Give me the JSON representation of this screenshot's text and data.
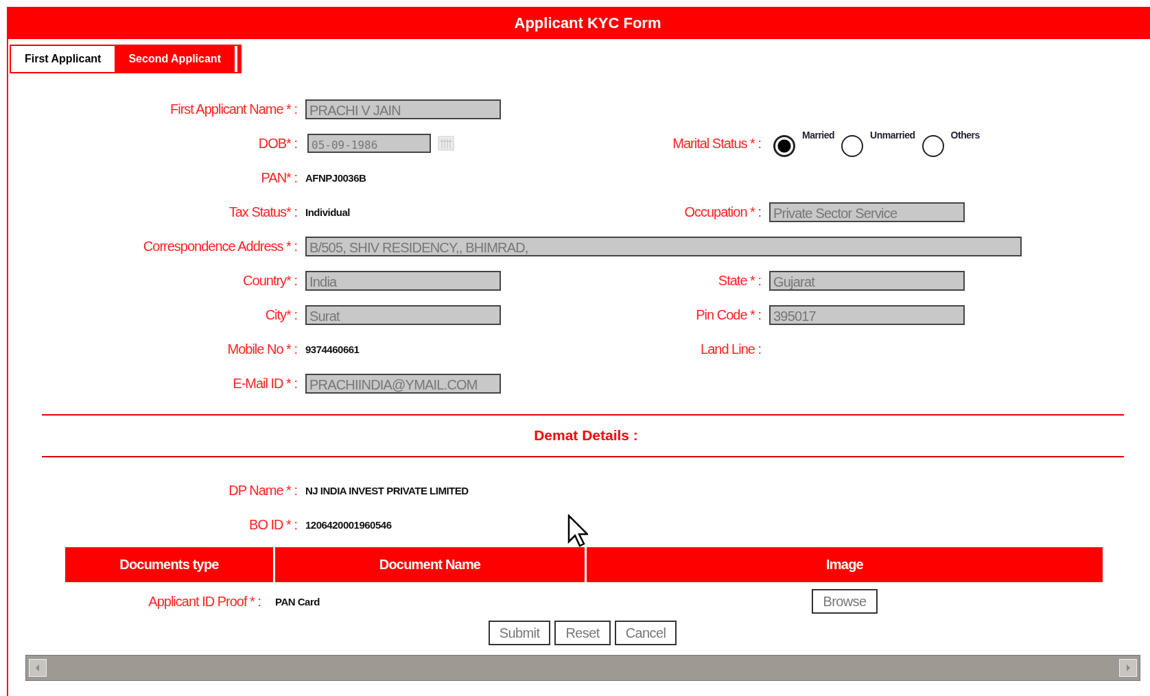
{
  "window": {
    "title": "Applicant KYC Form"
  },
  "tabs": [
    {
      "label": "First Applicant",
      "selected": true
    },
    {
      "label": "Second Applicant",
      "selected": false
    }
  ],
  "rows": [
    {
      "left": {
        "label": "First Applicant Name * :",
        "kind": "input",
        "value": "PRACHI V JAIN"
      }
    },
    {
      "left": {
        "label": "DOB* :",
        "kind": "date",
        "value": "05-09-1986"
      },
      "right": {
        "label": "Marital Status * :",
        "kind": "radio",
        "options": [
          {
            "label": "Married",
            "selected": true
          },
          {
            "label": "Unmarried",
            "selected": false
          },
          {
            "label": "Others",
            "selected": false
          }
        ]
      }
    },
    {
      "left": {
        "label": "PAN* :",
        "kind": "text",
        "value": "AFNPJ0036B"
      }
    },
    {
      "left": {
        "label": "Tax Status* :",
        "kind": "text",
        "value": "Individual"
      },
      "right": {
        "label": "Occupation * :",
        "kind": "input",
        "value": "Private Sector Service"
      }
    },
    {
      "left": {
        "label": "Correspondence Address * :",
        "kind": "wide",
        "value": "B/505, SHIV RESIDENCY,, BHIMRAD,"
      }
    },
    {
      "left": {
        "label": "Country* :",
        "kind": "input",
        "value": "India"
      },
      "right": {
        "label": "State * :",
        "kind": "input",
        "value": "Gujarat"
      }
    },
    {
      "left": {
        "label": "City* :",
        "kind": "input",
        "value": "Surat"
      },
      "right": {
        "label": "Pin Code * :",
        "kind": "input",
        "value": "395017"
      }
    },
    {
      "left": {
        "label": "Mobile No * :",
        "kind": "text",
        "value": "9374460661"
      },
      "right": {
        "label": "Land Line :",
        "kind": "text"
      }
    },
    {
      "left": {
        "label": "E-Mail ID * :",
        "kind": "input",
        "value": "PRACHIINDIA@YMAIL.COM"
      }
    }
  ],
  "demat": {
    "heading": "Demat Details :",
    "rows": [
      {
        "label": "DP Name * :",
        "value": "NJ INDIA INVEST PRIVATE LIMITED"
      },
      {
        "label": "BO ID * :",
        "value": "1206420001960546"
      }
    ]
  },
  "documents": {
    "columns": [
      "Documents type",
      "Document Name",
      "Image"
    ],
    "rows": [
      {
        "type": "Applicant ID Proof * :",
        "name": "PAN Card",
        "action": "Browse"
      }
    ]
  },
  "buttons": [
    "Submit",
    "Reset",
    "Cancel"
  ]
}
